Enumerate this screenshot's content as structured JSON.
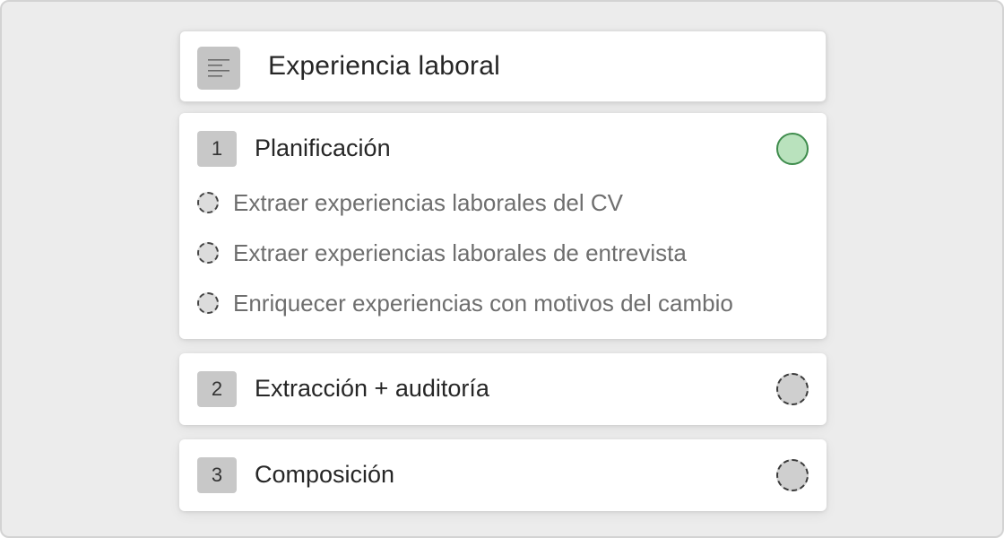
{
  "header": {
    "title": "Experiencia laboral",
    "icon": "align-left-icon"
  },
  "stages": [
    {
      "number": "1",
      "title": "Planificación",
      "status": "done",
      "steps": [
        "Extraer experiencias laborales del CV",
        "Extraer experiencias laborales de entrevista",
        "Enriquecer experiencias con motivos del cambio"
      ]
    },
    {
      "number": "2",
      "title": "Extracción + auditoría",
      "status": "pending"
    },
    {
      "number": "3",
      "title": "Composición",
      "status": "pending"
    }
  ],
  "colors": {
    "done_fill": "#b9e2bd",
    "done_border": "#3f8c4d",
    "pending_fill": "#cfcfcf"
  }
}
